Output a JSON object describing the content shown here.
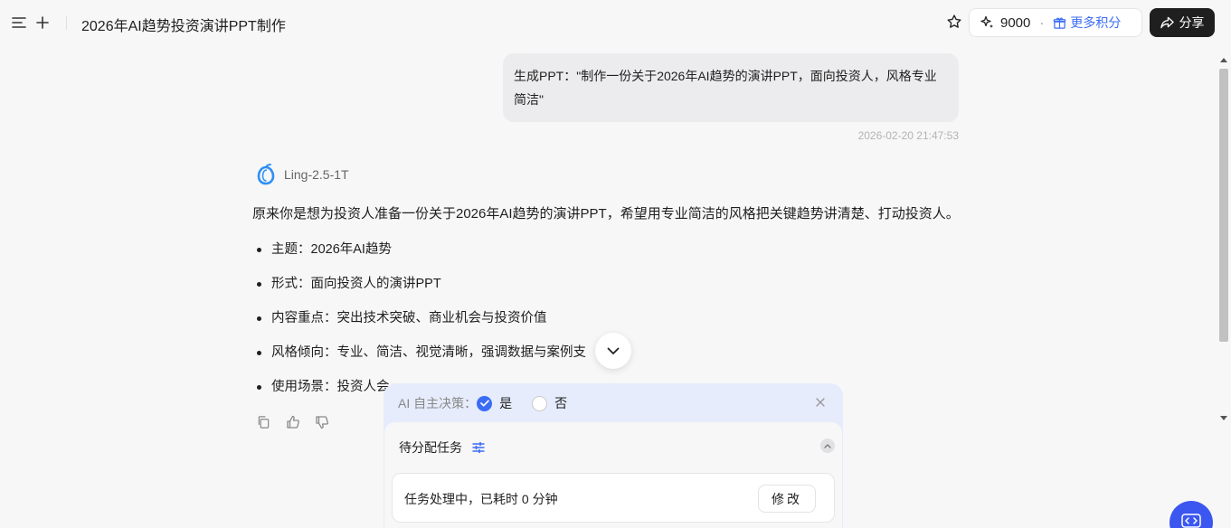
{
  "header": {
    "title": "2026年AI趋势投资演讲PPT制作",
    "points": "9000",
    "points_sep": "·",
    "more_points": "更多积分",
    "share": "分享"
  },
  "conversation": {
    "user_message": "生成PPT：\"制作一份关于2026年AI趋势的演讲PPT，面向投资人，风格专业简洁\"",
    "timestamp": "2026-02-20 21:47:53",
    "model_name": "Ling-2.5-1T",
    "intro": "原来你是想为投资人准备一份关于2026年AI趋势的演讲PPT，希望用专业简洁的风格把关键趋势讲清楚、打动投资人。",
    "bullets": [
      "主题：2026年AI趋势",
      "形式：面向投资人的演讲PPT",
      "内容重点：突出技术突破、商业机会与投资价值",
      "风格倾向：专业、简洁、视觉清晰，强调数据与案例支",
      "使用场景：投资人会"
    ]
  },
  "panel": {
    "ai_decision_label": "AI 自主决策：",
    "option_yes": "是",
    "option_no": "否",
    "selected": "是",
    "task_title": "待分配任务",
    "status_text": "任务处理中，已耗时 0 分钟",
    "edit_button": "修改"
  },
  "colors": {
    "accent": "#3b6cf6",
    "share_bg": "#1f1f1f",
    "panel_bg": "#e6ecfb"
  }
}
